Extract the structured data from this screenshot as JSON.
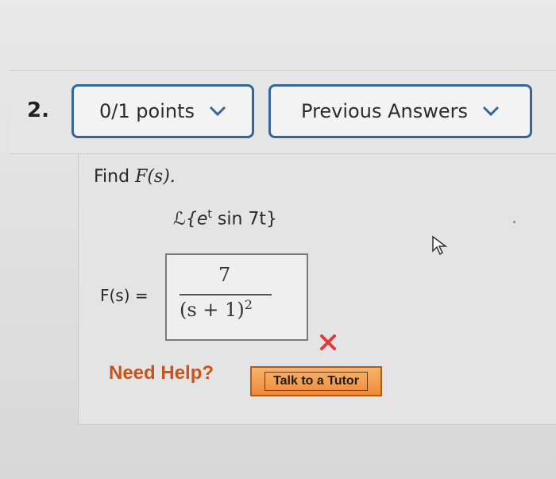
{
  "question": {
    "number": "2.",
    "points_label": "0/1 points",
    "answers_label": "Previous Answers",
    "prompt": "Find",
    "prompt_fn": "F(s).",
    "expression": "ℒ{e",
    "expression_sup": "t",
    "expression_rest": " sin 7t}",
    "answer_label": "F(s) =",
    "answer_numerator": "7",
    "answer_denominator": "(s + 1)",
    "answer_exponent": "2",
    "status": "incorrect"
  },
  "help": {
    "need_help_label": "Need Help?",
    "tutor_button_label": "Talk to a Tutor"
  },
  "colors": {
    "pill_border": "#35669a",
    "need_help": "#c8541c",
    "tutor_button": "#f08a3a",
    "wrong_mark": "#e03b3b"
  },
  "icons": [
    "chevron-down-icon",
    "close-icon",
    "cursor-pointer-icon"
  ]
}
